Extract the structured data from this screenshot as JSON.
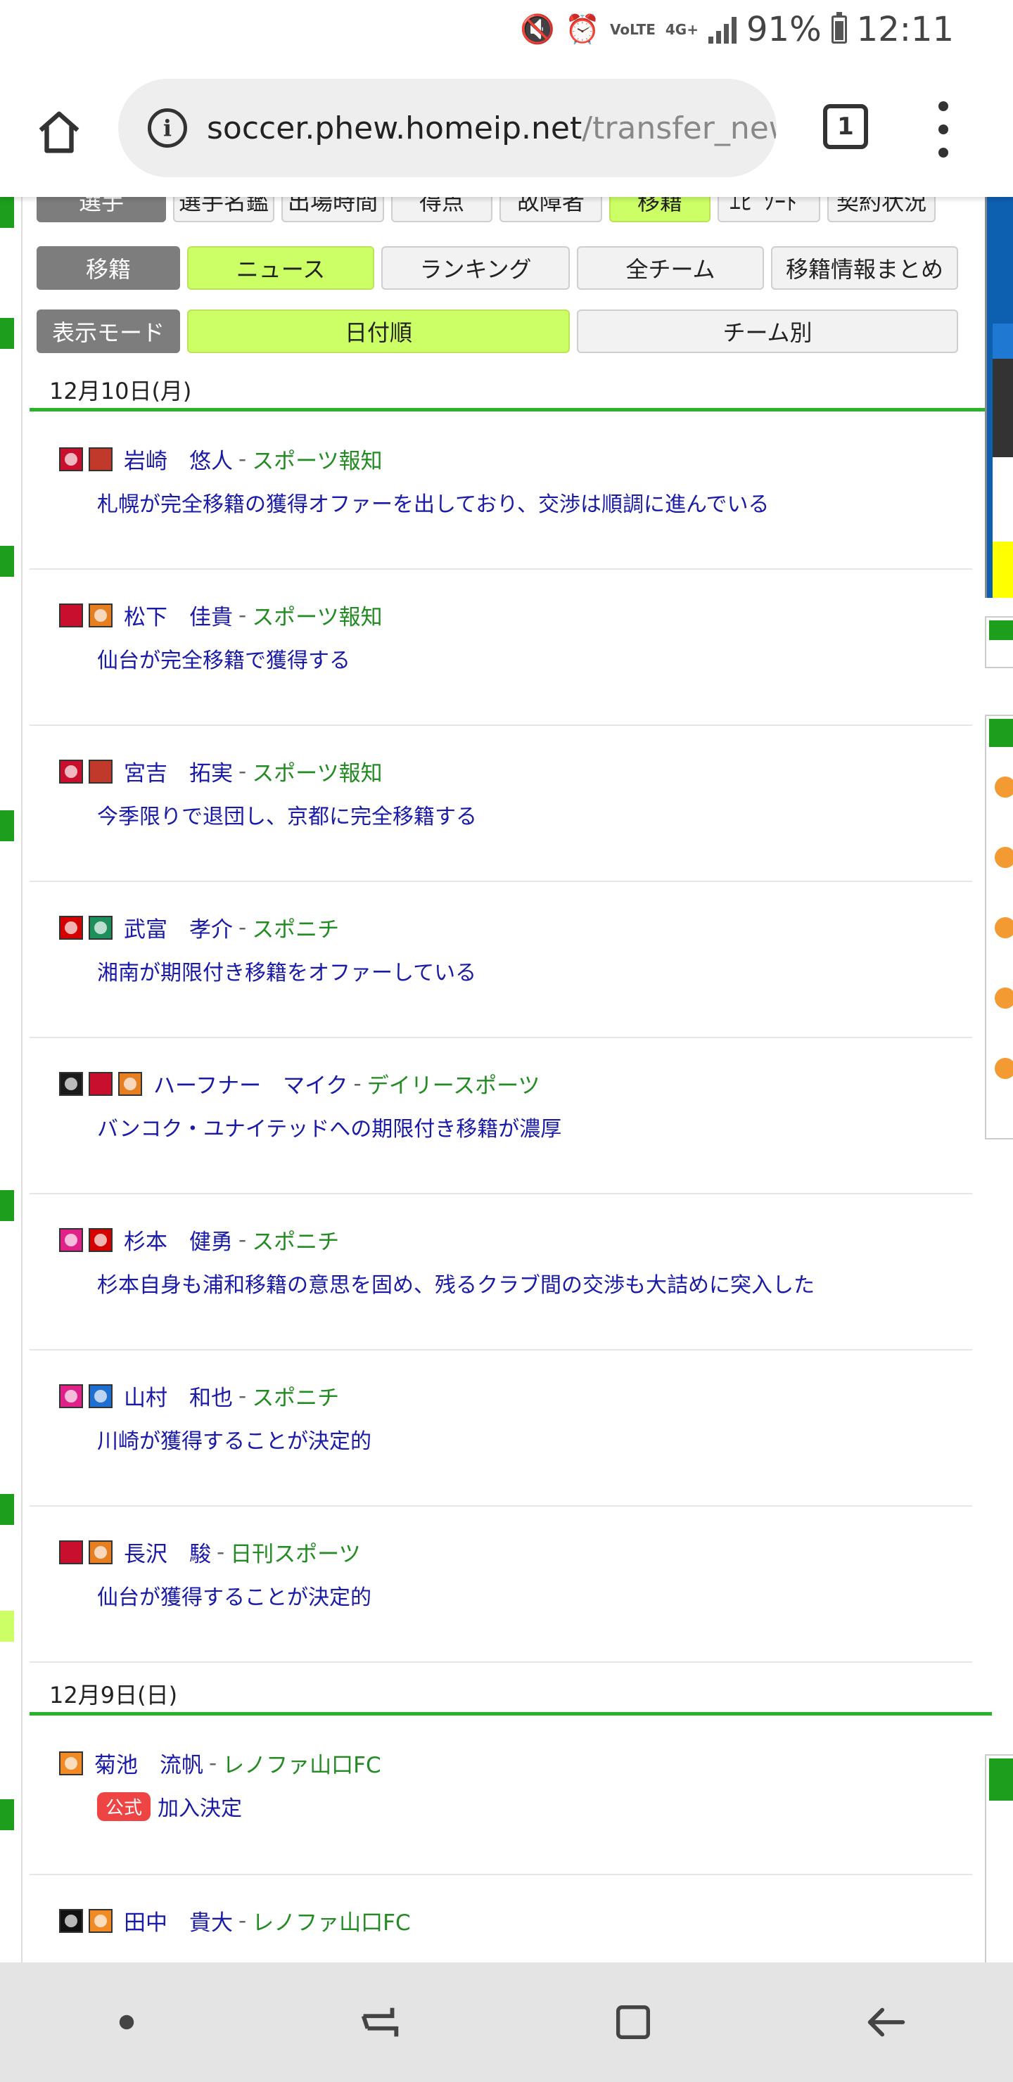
{
  "status_bar": {
    "network_label": "4G+",
    "volte_label": "VoLTE",
    "battery_percent": "91%",
    "battery_level": 0.91,
    "time": "12:11"
  },
  "browser": {
    "url_host": "soccer.phew.homeip.net",
    "url_path": "/transfer_new",
    "tab_count": "1"
  },
  "nav_row1": {
    "label": "選手",
    "items": [
      "選手名鑑",
      "出場時間",
      "得点",
      "故障者",
      "移籍",
      "ｴﾋﾟｿｰﾄﾞ",
      "契約状況"
    ],
    "active": "移籍"
  },
  "nav_row2": {
    "label": "移籍",
    "items": [
      "ニュース",
      "ランキング",
      "全チーム",
      "移籍情報まとめ"
    ],
    "active": "ニュース"
  },
  "nav_row3": {
    "label": "表示モード",
    "items": [
      "日付順",
      "チーム別"
    ],
    "active": "日付順"
  },
  "sections": [
    {
      "date": "12月10日(月)",
      "items": [
        {
          "icons": [
            "#c8102e",
            "#c0392b"
          ],
          "player": "岩崎　悠人",
          "source": "スポーツ報知",
          "text": "札幌が完全移籍の獲得オファーを出しており、交渉は順調に進んでいる"
        },
        {
          "icons": [
            "#c8102e",
            "#e67e22"
          ],
          "player": "松下　佳貴",
          "source": "スポーツ報知",
          "text": "仙台が完全移籍で獲得する"
        },
        {
          "icons": [
            "#c8102e",
            "#c0392b"
          ],
          "player": "宮吉　拓実",
          "source": "スポーツ報知",
          "text": "今季限りで退団し、京都に完全移籍する"
        },
        {
          "icons": [
            "#d40000",
            "#1d8f5a"
          ],
          "player": "武富　孝介",
          "source": "スポニチ",
          "text": "湘南が期限付き移籍をオファーしている"
        },
        {
          "icons": [
            "#1a1a1a",
            "#c8102e",
            "#e67e22"
          ],
          "player": "ハーフナー　マイク",
          "source": "デイリースポーツ",
          "text": "バンコク・ユナイテッドへの期限付き移籍が濃厚"
        },
        {
          "icons": [
            "#e0218a",
            "#d40000"
          ],
          "player": "杉本　健勇",
          "source": "スポニチ",
          "text": "杉本自身も浦和移籍の意思を固め、残るクラブ間の交渉も大詰めに突入した"
        },
        {
          "icons": [
            "#e0218a",
            "#1f6fd1"
          ],
          "player": "山村　和也",
          "source": "スポニチ",
          "text": "川崎が獲得することが決定的"
        },
        {
          "icons": [
            "#c8102e",
            "#e67e22"
          ],
          "player": "長沢　駿",
          "source": "日刊スポーツ",
          "text": "仙台が獲得することが決定的"
        }
      ]
    },
    {
      "date": "12月9日(日)",
      "items": [
        {
          "icons": [
            "#f08a24"
          ],
          "player": "菊池　流帆",
          "source": "レノファ山口FC",
          "badge": "公式",
          "text": "加入決定"
        },
        {
          "icons": [
            "#111111",
            "#f08a24"
          ],
          "player": "田中　貴大",
          "source": "レノファ山口FC",
          "text": ""
        }
      ]
    }
  ],
  "colors": {
    "accent_green": "#28b428",
    "active_lime": "#ccff66",
    "link_blue": "#1a1aa8",
    "source_green": "#228b22"
  }
}
